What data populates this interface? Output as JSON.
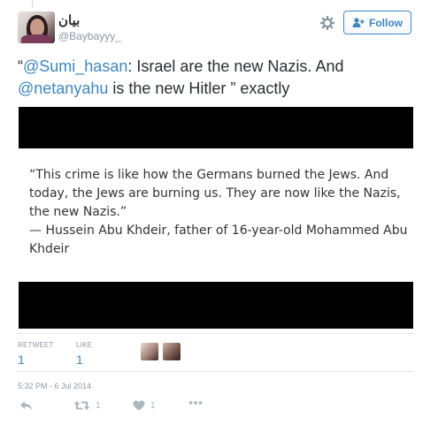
{
  "user": {
    "display_name": "بيان",
    "handle": "@Baybayyy_"
  },
  "follow_button": {
    "label": "Follow"
  },
  "tweet": {
    "open_quote": "“",
    "mention1": "@Sumi_hasan",
    "text1": ": Israel are the new Nazis. And ",
    "mention2": "@netanyahu",
    "text2": " is the new Hitler ” exactly"
  },
  "card": {
    "quote_line": "“This crime is like how the Germans burned the Jews. And today, the Jews are burning us. They are now like the Nazis, the new Nazis.”",
    "attribution": "—  Hussein Abu Khdeir, father of 16-year-old Mohammed Abu Khdeir"
  },
  "stats": {
    "retweet_label": "RETWEET",
    "retweet_count": "1",
    "like_label": "LIKE",
    "like_count": "1"
  },
  "timestamp": "5:32 PM - 6 Jul 2014",
  "actions": {
    "retweet_count": "1",
    "like_count": "1"
  },
  "icons": {
    "settings": "gear-icon",
    "follow": "add-user-icon",
    "reply": "reply-icon",
    "retweet": "retweet-icon",
    "like": "heart-icon",
    "more": "more-icon"
  },
  "colors": {
    "link": "#3b88c3",
    "muted": "#8899a6",
    "card_frame": "#000000"
  }
}
